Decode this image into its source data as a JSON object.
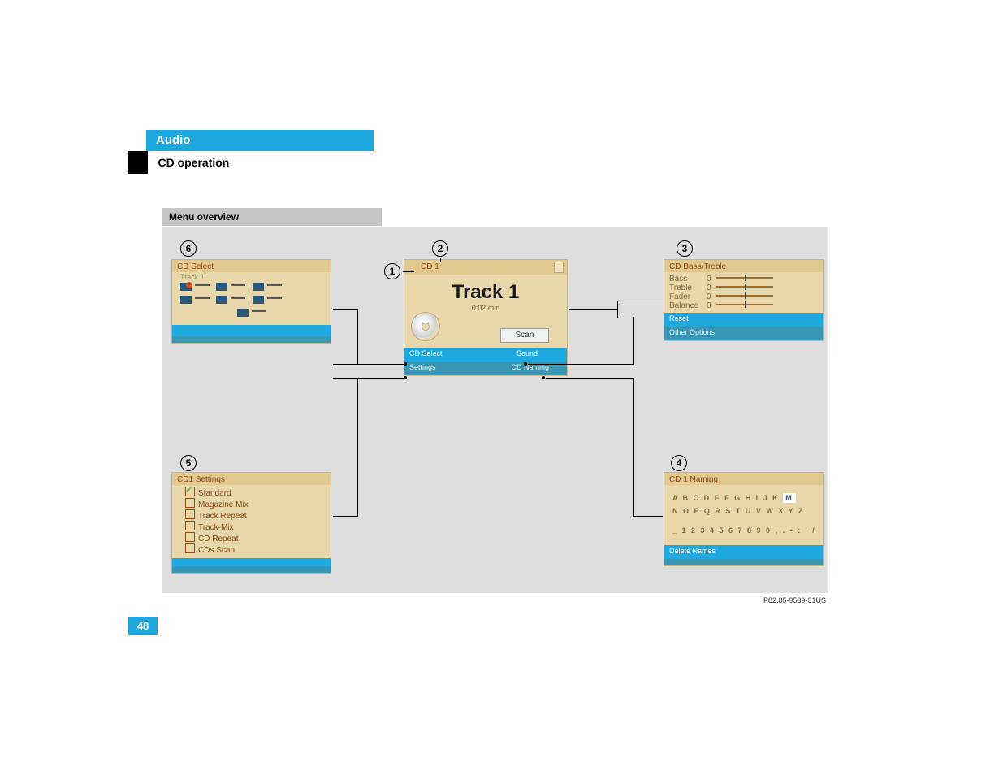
{
  "header": {
    "tab": "Audio",
    "sub": "CD operation"
  },
  "section_title": "Menu overview",
  "page_number": "48",
  "figure_ref": "P82.85-9539-31US",
  "callouts": {
    "c1": "1",
    "c2": "2",
    "c3": "3",
    "c4": "4",
    "c5": "5",
    "c6": "6"
  },
  "panel1": {
    "title": "CD 1",
    "track": "Track 1",
    "time": "0:02 min",
    "button_scan": "Scan",
    "menu_cd_select": "CD Select",
    "menu_settings": "Settings",
    "menu_sound": "Sound",
    "menu_cd_naming": "CD Naming"
  },
  "panel3": {
    "title": "CD Bass/Treble",
    "rows": [
      {
        "label": "Bass",
        "value": "0"
      },
      {
        "label": "Treble",
        "value": "0"
      },
      {
        "label": "Fader",
        "value": "0"
      },
      {
        "label": "Balance",
        "value": "0"
      }
    ],
    "reset": "Reset",
    "other": "Other Options"
  },
  "panel4": {
    "title": "CD 1 Naming",
    "row1": "A B C D E F G H I J K",
    "row1_hi": "M",
    "row2": "N O P Q R S T U V W X Y Z",
    "row3": "_ 1 2 3 4 5 6 7 8 9 0 , . - : ' /",
    "delete": "Delete Names"
  },
  "panel5": {
    "title": "CD1 Settings",
    "items": [
      {
        "label": "Standard",
        "checked": true
      },
      {
        "label": "Magazine Mix",
        "checked": false
      },
      {
        "label": "Track Repeat",
        "checked": false
      },
      {
        "label": "Track-Mix",
        "checked": false
      },
      {
        "label": "CD Repeat",
        "checked": false
      },
      {
        "label": "CDs Scan",
        "checked": false
      }
    ]
  },
  "panel6": {
    "title": "CD Select",
    "sub": "Track 1"
  }
}
